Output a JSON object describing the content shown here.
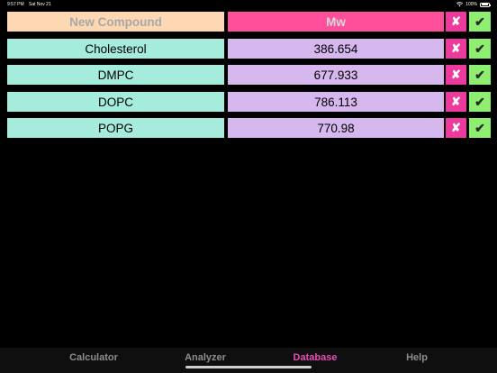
{
  "status_bar": {
    "time": "9:57 PM",
    "date": "Sat Nov 21",
    "battery": "100%"
  },
  "header": {
    "name_placeholder": "New Compound",
    "mw_placeholder": "Mw",
    "delete_glyph": "✘",
    "confirm_glyph": "✔"
  },
  "compounds": [
    {
      "name": "Cholesterol",
      "mw": "386.654"
    },
    {
      "name": "DMPC",
      "mw": "677.933"
    },
    {
      "name": "DOPC",
      "mw": "786.113"
    },
    {
      "name": "POPG",
      "mw": "770.98"
    }
  ],
  "row_buttons": {
    "delete_glyph": "✘",
    "confirm_glyph": "✔"
  },
  "tabs": [
    {
      "label": "Calculator",
      "active": false
    },
    {
      "label": "Analyzer",
      "active": false
    },
    {
      "label": "Database",
      "active": true
    },
    {
      "label": "Help",
      "active": false
    }
  ],
  "colors": {
    "name_cell": "#a6ecdc",
    "mw_cell": "#d7b8ee",
    "header_name": "#fed8b3",
    "header_mw": "#ff4f9a",
    "delete_button": "#ee3a9c",
    "confirm_button": "#8dee6f",
    "active_tab": "#e54eb6"
  },
  "icons": [
    "wifi-icon",
    "battery-icon",
    "delete-icon",
    "confirm-icon"
  ]
}
